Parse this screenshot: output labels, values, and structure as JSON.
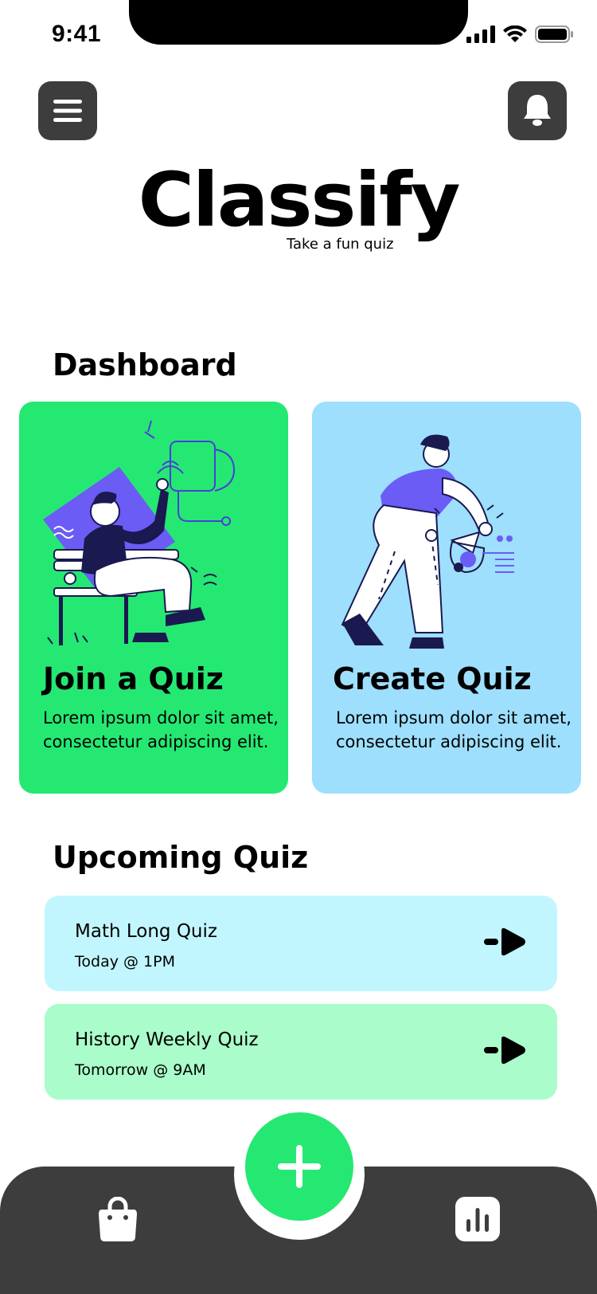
{
  "status": {
    "time": "9:41"
  },
  "header": {
    "menu_icon": "hamburger-menu-icon",
    "bell_icon": "bell-icon"
  },
  "logo": {
    "title": "Classify",
    "subtitle": "Take a fun quiz"
  },
  "dashboard": {
    "title": "Dashboard",
    "cards": [
      {
        "title": "Join a Quiz",
        "description": "Lorem ipsum dolor sit amet, consectetur adipiscing elit.",
        "color": "#25e872"
      },
      {
        "title": "Create Quiz",
        "description": "Lorem ipsum dolor sit amet, consectetur adipiscing elit.",
        "color": "#9ddffd"
      }
    ]
  },
  "upcoming": {
    "title": "Upcoming Quiz",
    "items": [
      {
        "name": "Math Long Quiz",
        "time": "Today @ 1PM",
        "color": "#c2f6fe"
      },
      {
        "name": "History Weekly Quiz",
        "time": "Tomorrow @ 9AM",
        "color": "#aafcca"
      }
    ]
  },
  "bottom_nav": {
    "left_icon": "shopping-bag-icon",
    "center_icon": "plus-icon",
    "right_icon": "bar-chart-icon",
    "accent": "#25e872",
    "background": "#3d3d3d"
  }
}
